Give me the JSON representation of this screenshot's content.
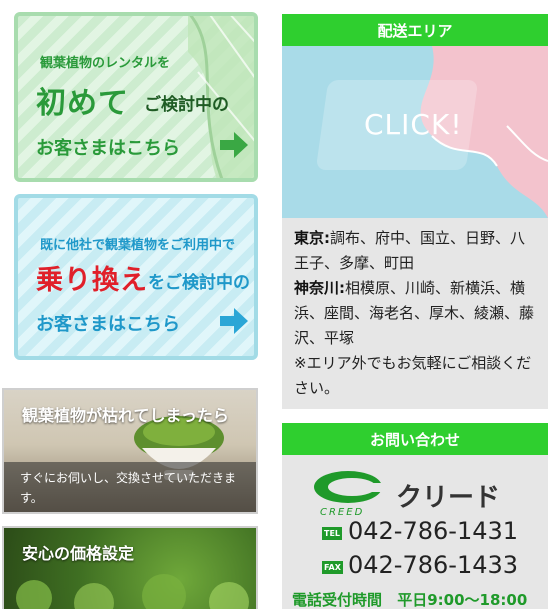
{
  "banners": {
    "first": {
      "line1": "観葉植物のレンタルを",
      "big": "初めて",
      "mid": "ご検討中の",
      "cust": "お客さまはこちら"
    },
    "switch": {
      "line1": "既に他社で観葉植物をご利用中で",
      "big": "乗り換え",
      "mid": "をご検討中の",
      "cust": "お客さまはこちら"
    }
  },
  "photos": {
    "wither": {
      "title": "観葉植物が枯れてしまったら",
      "body": "すぐにお伺いし、交換させていただきます。"
    },
    "price": {
      "title": "安心の価格設定"
    }
  },
  "delivery": {
    "header": "配送エリア",
    "map_label": "CLICK!",
    "tokyo_label": "東京:",
    "tokyo_areas": "調布、府中、国立、日野、八王子、多摩、町田",
    "kanagawa_label": "神奈川:",
    "kanagawa_areas": "相模原、川崎、新横浜、横浜、座間、海老名、厚木、綾瀬、藤沢、平塚",
    "note": "※エリア外でもお気軽にご相談ください。"
  },
  "contact": {
    "header": "お問い合わせ",
    "logo_text": "クリード",
    "logo_sub": "CREED",
    "tel_badge": "TEL",
    "tel": "042-786-1431",
    "fax_badge": "FAX",
    "fax": "042-786-1433",
    "hours_label": "電話受付時間",
    "hours": "平日9:00〜18:00"
  },
  "colors": {
    "green": "#2fcf2f",
    "banner_green_text": "#2a9a3a",
    "banner_blue_text": "#1f98c9",
    "accent_red": "#e0202a",
    "map_pink": "#f4c2cc",
    "map_blue": "#a9dbe8"
  }
}
